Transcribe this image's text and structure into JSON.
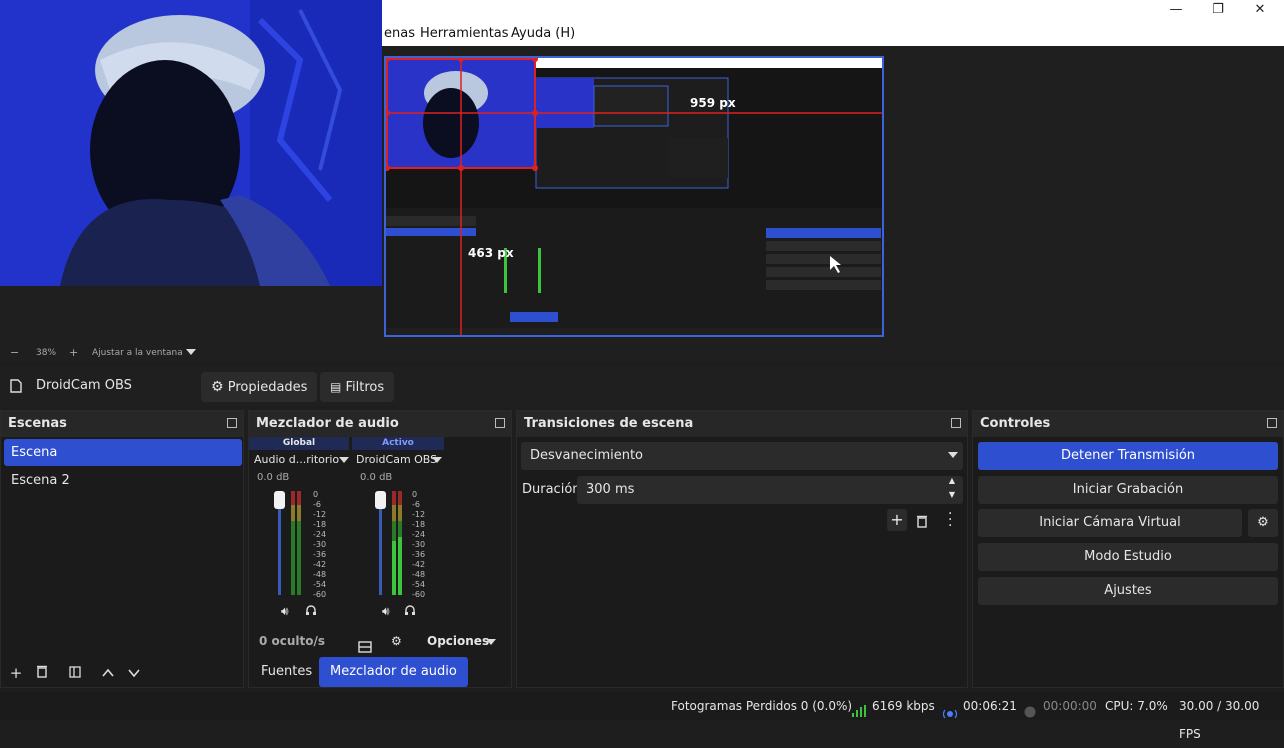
{
  "window": {
    "minimize_glyph": "—",
    "restore_glyph": "❐",
    "close_glyph": "✕"
  },
  "menu": {
    "items": [
      "enas",
      "Herramientas",
      "Ayuda (H)"
    ]
  },
  "preview": {
    "nested_labels": {
      "width_px": "959 px",
      "height_px": "463 px"
    }
  },
  "zoom": {
    "minus": "−",
    "level": "38%",
    "plus": "+",
    "fit_label": "Ajustar a la ventana"
  },
  "source_bar": {
    "source_name": "DroidCam OBS",
    "properties_label": "Propiedades",
    "filters_label": "Filtros"
  },
  "scenes": {
    "title": "Escenas",
    "items": [
      {
        "label": "Escena",
        "selected": true
      },
      {
        "label": "Escena 2",
        "selected": false
      }
    ]
  },
  "mixer": {
    "title": "Mezclador de audio",
    "channels": [
      {
        "header": "Global",
        "name": "Audio d...ritorio",
        "level": "0.0 dB"
      },
      {
        "header": "Activo",
        "name": "DroidCam OBS",
        "level": "0.0 dB"
      }
    ],
    "scale": [
      "0",
      "-6",
      "-12",
      "-18",
      "-24",
      "-30",
      "-36",
      "-42",
      "-48",
      "-54",
      "-60"
    ],
    "hidden_label": "0 oculto/s",
    "options_label": "Opciones",
    "tabs": [
      {
        "label": "Fuentes",
        "active": false
      },
      {
        "label": "Mezclador de audio",
        "active": true
      }
    ]
  },
  "transitions": {
    "title": "Transiciones de escena",
    "selected": "Desvanecimiento",
    "duration_label": "Duración",
    "duration_value": "300 ms"
  },
  "controls": {
    "title": "Controles",
    "buttons": [
      {
        "label": "Detener Transmisión",
        "active": true
      },
      {
        "label": "Iniciar Grabación",
        "active": false
      },
      {
        "label": "Iniciar Cámara Virtual",
        "active": false
      },
      {
        "label": "Modo Estudio",
        "active": false
      },
      {
        "label": "Ajustes",
        "active": false
      }
    ]
  },
  "status": {
    "dropped_frames": "Fotogramas Perdidos 0 (0.0%)",
    "bitrate": "6169 kbps",
    "stream_time": "00:06:21",
    "rec_time": "00:00:00",
    "cpu": "CPU: 7.0%",
    "fps": "30.00 / 30.00 FPS"
  },
  "colors": {
    "accent": "#2f4fd1",
    "panel": "#1b1b1b",
    "button": "#2b2b2b",
    "signal_green": "#3cc43c",
    "selection_red": "#e02020"
  }
}
